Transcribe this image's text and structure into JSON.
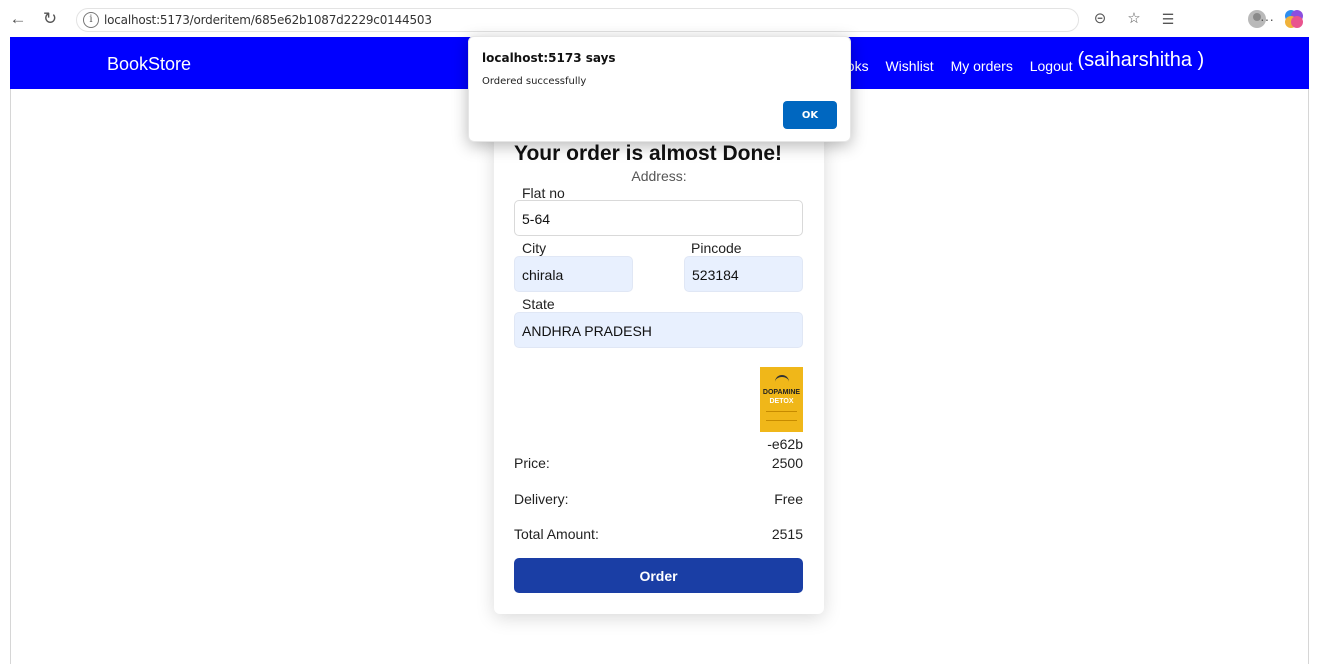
{
  "browser": {
    "url": "localhost:5173/orderitem/685e62b1087d2229c0144503",
    "icons": [
      "back-arrow-icon",
      "reload-icon",
      "info-icon",
      "reader-icon",
      "star-icon",
      "favorites-icon",
      "profile-icon",
      "more-icon",
      "copilot-icon"
    ],
    "more_label": "···"
  },
  "navbar": {
    "brand": "BookStore",
    "links": [
      "ooks",
      "Wishlist",
      "My orders",
      "Logout"
    ],
    "user": "(saiharshitha )",
    "color": "#0000ff"
  },
  "dialog": {
    "title": "localhost:5173 says",
    "message": "Ordered successfully",
    "ok_label": "OK"
  },
  "order": {
    "heading": "Your order is almost Done!",
    "address_label": "Address:",
    "flat_label": "Flat no",
    "flat_value": "5-64",
    "city_label": "City",
    "city_value": "chirala",
    "pincode_label": "Pincode",
    "pincode_value": "523184",
    "state_label": "State",
    "state_value": "ANDHRA PRADESH",
    "book_cover_title_1": "DOPAMINE",
    "book_cover_title_2": "DETOX",
    "book_id": "-e62b",
    "price_label": "Price:",
    "price_value": "2500",
    "delivery_label": "Delivery:",
    "delivery_value": "Free",
    "total_label": "Total Amount:",
    "total_value": "2515",
    "order_button": "Order",
    "button_color": "#1a3ea5"
  }
}
